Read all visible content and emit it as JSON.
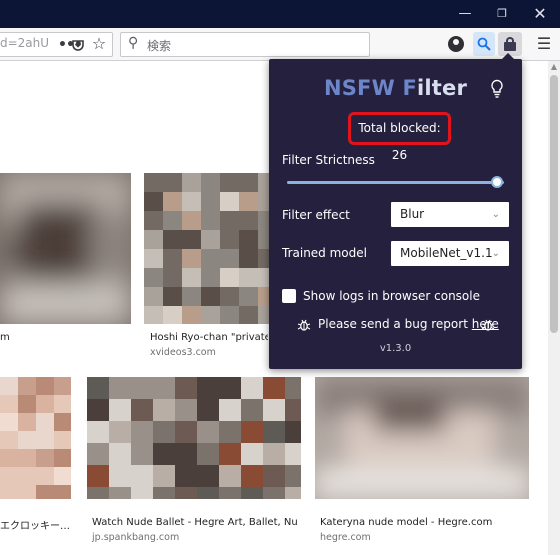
{
  "toolbar": {
    "url_text": "d=2ahU",
    "search_placeholder": "検索"
  },
  "results": [
    {
      "caption": "m",
      "source": ""
    },
    {
      "caption": "Hoshi Ryo-chan \"private n",
      "source": "xvideos3.com"
    },
    {
      "caption": "エクロッキー…",
      "source": ""
    },
    {
      "caption": "Watch Nude Ballet - Hegre Art, Ballet, Nud…",
      "source": "jp.spankbang.com"
    },
    {
      "caption": "Kateryna nude model - Hegre.com",
      "source": "hegre.com"
    }
  ],
  "popup": {
    "title_part1": "NSFW F",
    "title_part2": "ilter",
    "total_blocked": "Total blocked: 26",
    "strictness_label": "Filter Strictness",
    "strictness_value": 0.97,
    "effect_label": "Filter effect",
    "effect_value": "Blur",
    "model_label": "Trained model",
    "model_value": "MobileNet_v1.1",
    "logs_label": "Show logs in browser console",
    "logs_checked": false,
    "bug_text": "Please send a bug report ",
    "bug_link": "here",
    "version": "v1.3.0"
  },
  "colors": {
    "titlebar": "#0c1535",
    "popup_bg": "#25203d",
    "title_blue": "#6c86c9",
    "highlight_red": "#e1141e",
    "slider": "#8ab3e0"
  },
  "icons": [
    "minimize-icon",
    "maximize-icon",
    "close-icon",
    "more-dots-icon",
    "pocket-icon",
    "bookmark-star-icon",
    "search-icon",
    "account-icon",
    "zoom-icon",
    "nsfw-lock-icon",
    "hamburger-menu-icon",
    "lightbulb-icon",
    "bug-icon"
  ]
}
